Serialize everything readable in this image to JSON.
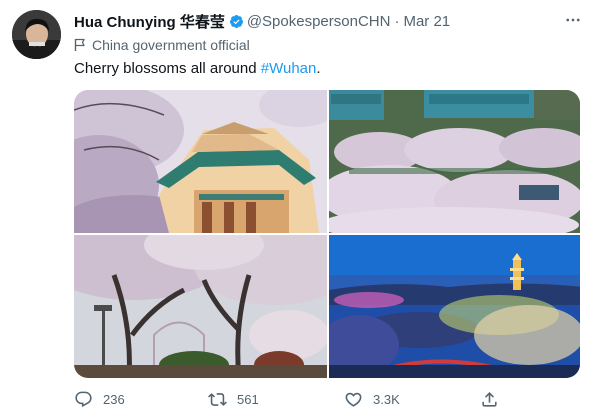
{
  "tweet": {
    "display_name": "Hua Chunying 华春莹",
    "handle": "@SpokespersonCHN",
    "separator": "·",
    "date": "Mar 21",
    "account_label": "China government official",
    "text_prefix": "Cherry blossoms all around ",
    "hashtag": "#Wuhan",
    "text_suffix": "."
  },
  "icons": {
    "verified": "verified-badge-icon",
    "more": "more-options-icon",
    "label": "flag-icon",
    "reply": "reply-icon",
    "retweet": "retweet-icon",
    "like": "heart-icon",
    "share": "share-icon"
  },
  "actions": {
    "reply_count": "236",
    "retweet_count": "561",
    "like_count": "3.3K"
  },
  "colors": {
    "accent": "#1d9bf0",
    "muted_text": "#536471",
    "text": "#0f1419"
  }
}
